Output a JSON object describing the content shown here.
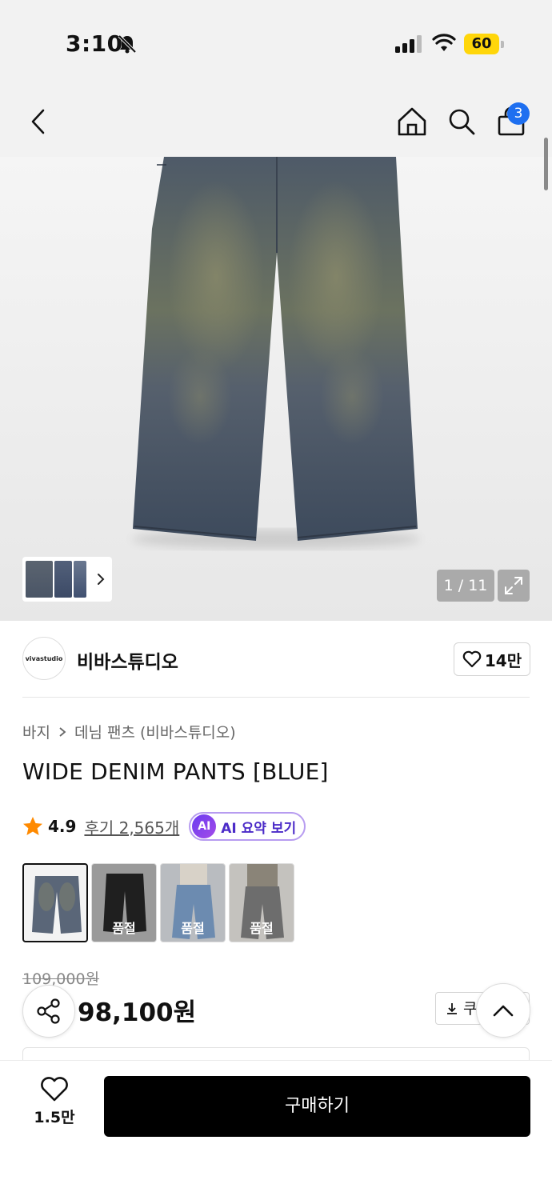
{
  "status_bar": {
    "time": "3:10",
    "battery": "60"
  },
  "header": {
    "cart_count": "3"
  },
  "gallery": {
    "counter": "1 / 11"
  },
  "brand": {
    "logo_text": "vivastudio",
    "name": "비바스튜디오",
    "likes": "14만"
  },
  "breadcrumb": {
    "category": "바지",
    "subcategory": "데님 팬츠 (비바스튜디오)"
  },
  "product": {
    "title": "WIDE DENIM PANTS [BLUE]",
    "rating": "4.9",
    "reviews": "후기 2,565개",
    "ai_badge": "AI",
    "ai_label": "AI 요약 보기",
    "original_price": "109,000원",
    "price": "98,100원"
  },
  "options": [
    {
      "label": "",
      "soldout": false
    },
    {
      "label": "품절",
      "soldout": true
    },
    {
      "label": "품절",
      "soldout": true
    },
    {
      "label": "품절",
      "soldout": true
    }
  ],
  "coupon_label": "쿠",
  "bottom_bar": {
    "wish_count": "1.5만",
    "buy_label": "구매하기"
  },
  "colors": {
    "accent_blue": "#1e6ff0",
    "battery": "#ffd60a",
    "ai_purple": "#6a3cf0",
    "star": "#ff8a00"
  }
}
